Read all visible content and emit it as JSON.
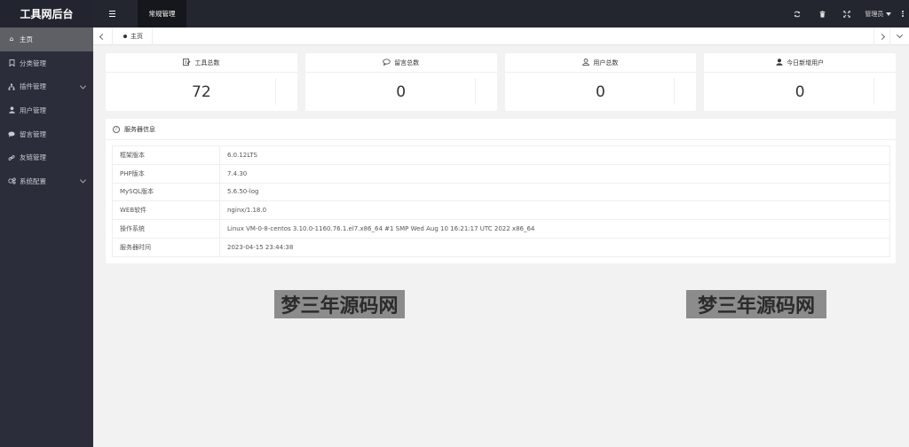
{
  "app": {
    "logo_text": "工具网后台"
  },
  "sidebar": {
    "items": [
      {
        "label": "主页",
        "icon": "home-icon",
        "active": true,
        "expandable": false
      },
      {
        "label": "分类管理",
        "icon": "bookmark-icon",
        "active": false,
        "expandable": false
      },
      {
        "label": "插件管理",
        "icon": "sitemap-icon",
        "active": false,
        "expandable": true
      },
      {
        "label": "用户管理",
        "icon": "user-icon",
        "active": false,
        "expandable": false
      },
      {
        "label": "留言管理",
        "icon": "comment-icon",
        "active": false,
        "expandable": false
      },
      {
        "label": "友链管理",
        "icon": "link-icon",
        "active": false,
        "expandable": false
      },
      {
        "label": "系统配置",
        "icon": "gears-icon",
        "active": false,
        "expandable": true
      }
    ]
  },
  "header": {
    "top_tab": "常规管理",
    "admin_label": "管理员",
    "icons": [
      "refresh-icon",
      "trash-icon",
      "fullscreen-icon",
      "more-vertical-icon"
    ]
  },
  "tabs": {
    "home_label": "主页"
  },
  "stats": [
    {
      "label": "工具总数",
      "value": "72",
      "icon": "tools-icon"
    },
    {
      "label": "留言总数",
      "value": "0",
      "icon": "comments-icon"
    },
    {
      "label": "用户总数",
      "value": "0",
      "icon": "users-icon"
    },
    {
      "label": "今日新增用户",
      "value": "0",
      "icon": "user-add-icon"
    }
  ],
  "server": {
    "title": "服务器信息",
    "rows": [
      {
        "key": "框架版本",
        "value": "6.0.12LTS"
      },
      {
        "key": "PHP版本",
        "value": "7.4.30"
      },
      {
        "key": "MySQL版本",
        "value": "5.6.50-log"
      },
      {
        "key": "WEB软件",
        "value": "nginx/1.18.0"
      },
      {
        "key": "操作系统",
        "value": "Linux VM-0-8-centos 3.10.0-1160.76.1.el7.x86_64 #1 SMP Wed Aug 10 16:21:17 UTC 2022 x86_64"
      },
      {
        "key": "服务器时间",
        "value": "2023-04-15 23:44:38"
      }
    ]
  },
  "watermark": {
    "text": "梦三年源码网"
  },
  "colors": {
    "sidebar_bg": "#2b2e3a",
    "topbar_bg": "#23262e",
    "active_item_bg": "#5f6066",
    "page_bg": "#f2f2f2"
  }
}
